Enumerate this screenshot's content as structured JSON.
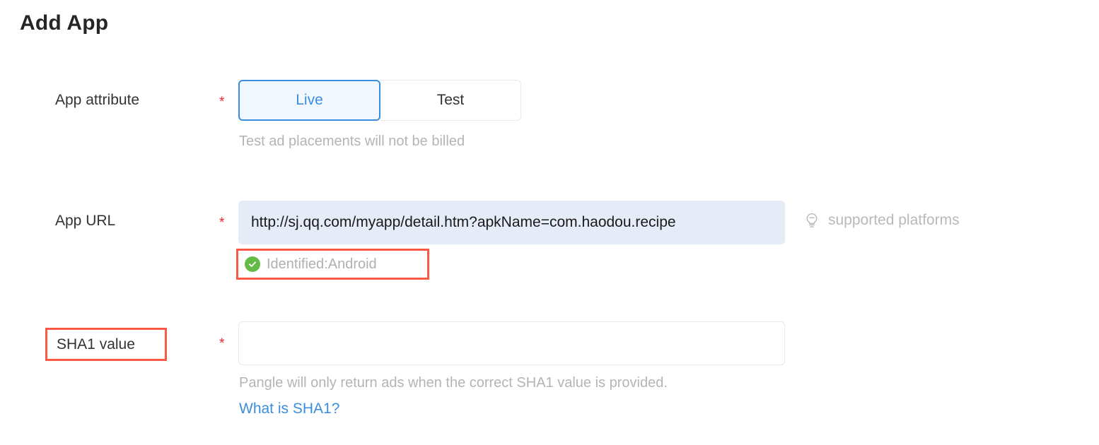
{
  "page": {
    "title": "Add App"
  },
  "fields": {
    "app_attribute": {
      "label": "App attribute",
      "required_mark": "*",
      "options": [
        {
          "label": "Live",
          "selected": true
        },
        {
          "label": "Test",
          "selected": false
        }
      ],
      "helper": "Test ad placements will not be billed"
    },
    "app_url": {
      "label": "App URL",
      "required_mark": "*",
      "value": "http://sj.qq.com/myapp/detail.htm?apkName=com.haodou.recipe",
      "placeholder": "",
      "identified_status": "Identified:Android",
      "status_icon": "check-circle-icon",
      "hint_icon": "lightbulb-icon",
      "hint_label": "supported platforms"
    },
    "sha1_value": {
      "label": "SHA1 value",
      "required_mark": "*",
      "value": "",
      "placeholder": "",
      "helper": "Pangle will only return ads when the correct SHA1 value is provided.",
      "link_label": "What is SHA1?"
    }
  },
  "colors": {
    "accent_blue": "#3c8ddd",
    "annotation_red": "#fa5a43",
    "required_star_red": "#f5222d",
    "success_green": "#63ba47",
    "url_field_background": "#e6ebf8",
    "helper_gray": "#b4b4b4"
  }
}
